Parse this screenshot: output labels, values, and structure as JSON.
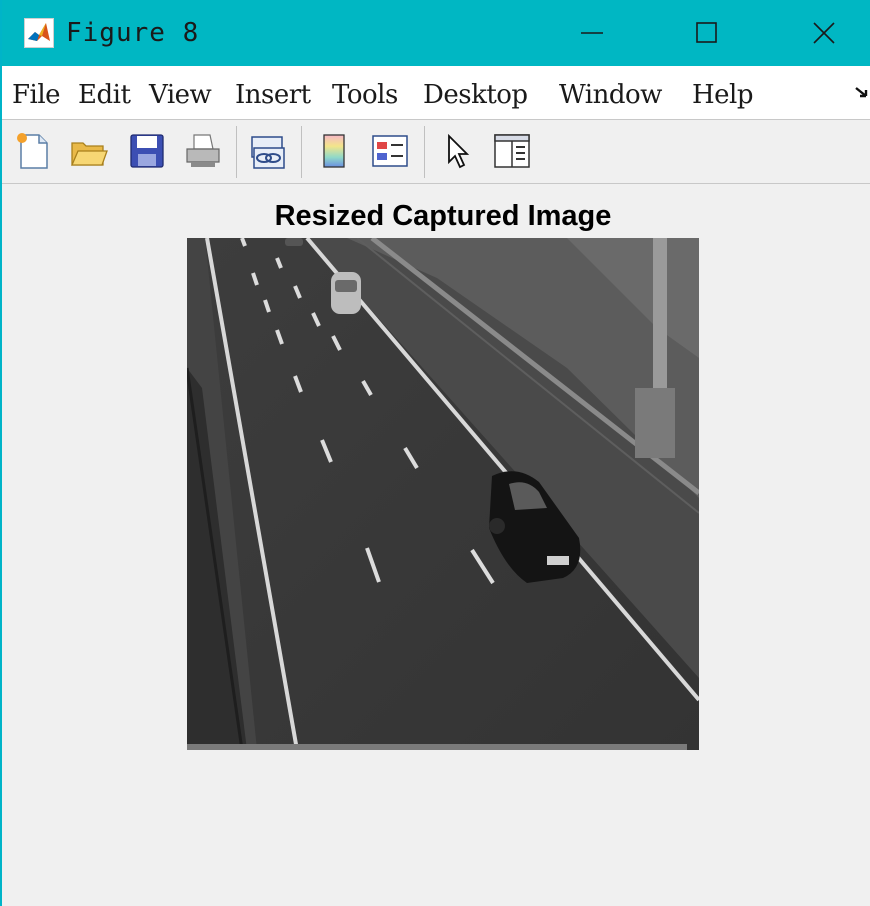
{
  "window": {
    "title": "Figure 8",
    "colors": {
      "titlebar": "#00b7c3",
      "background": "#f0f0f0"
    },
    "controls": [
      "minimize-icon",
      "maximize-icon",
      "close-icon"
    ]
  },
  "menubar": {
    "items": [
      {
        "label": "File"
      },
      {
        "label": "Edit"
      },
      {
        "label": "View"
      },
      {
        "label": "Insert"
      },
      {
        "label": "Tools"
      },
      {
        "label": "Desktop"
      },
      {
        "label": "Window"
      },
      {
        "label": "Help"
      }
    ]
  },
  "toolbar": {
    "tools": [
      "new-figure-icon",
      "open-file-icon",
      "save-icon",
      "print-icon",
      "link-plot-icon",
      "colorbar-icon",
      "legend-icon",
      "edit-plot-pointer-icon",
      "property-editor-icon"
    ]
  },
  "figure": {
    "title": "Resized Captured Image",
    "image": "grayscale highway scene with two cars"
  }
}
